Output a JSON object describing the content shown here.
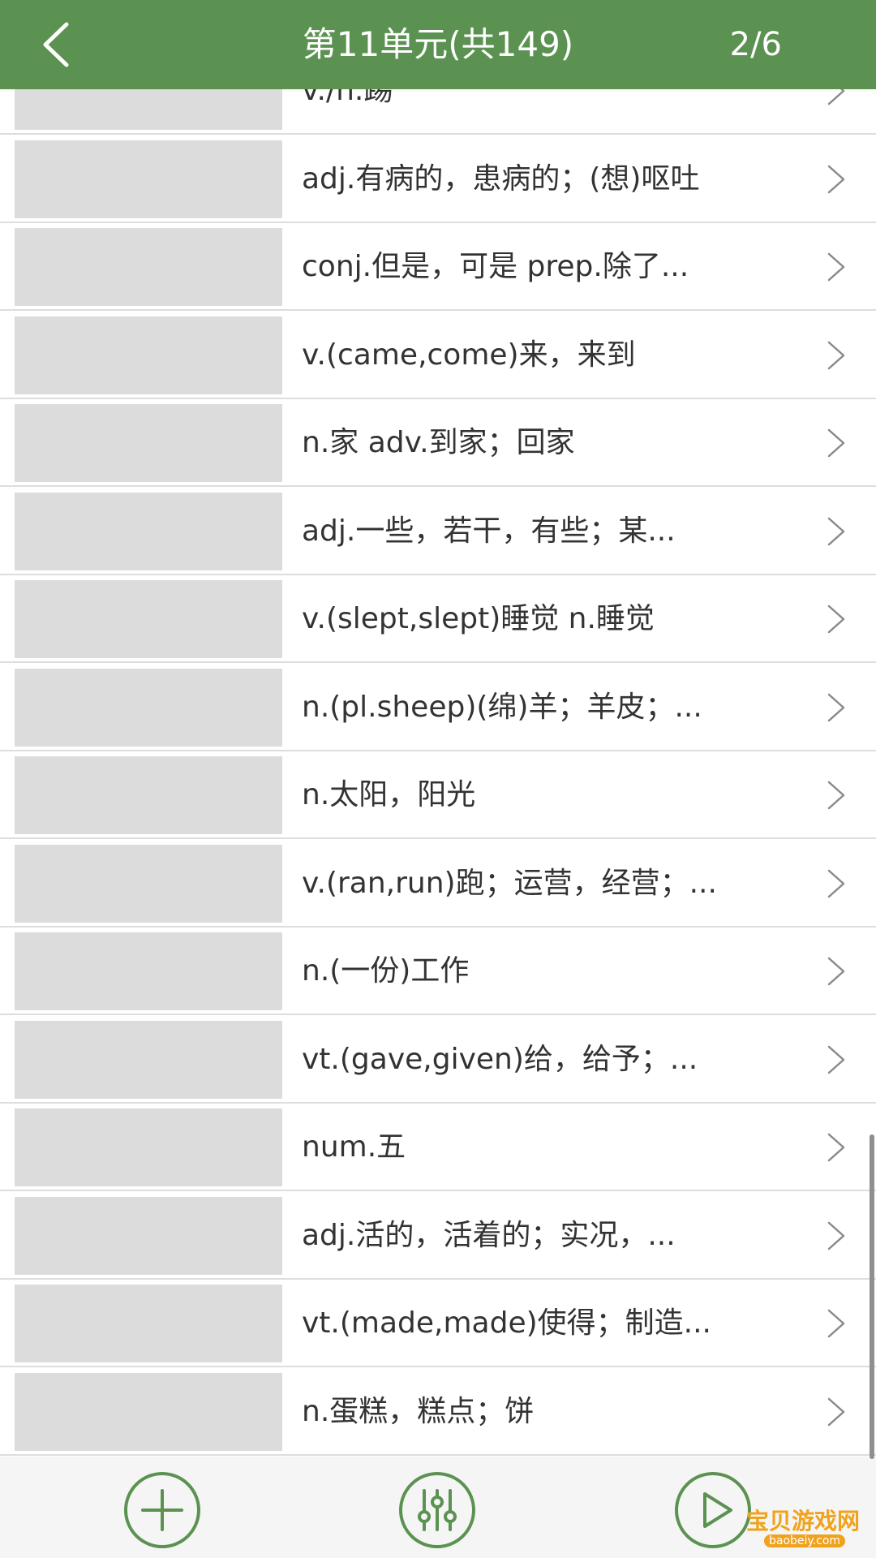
{
  "header": {
    "title": "第11单元(共149)",
    "page_indicator": "2/6",
    "back_icon": "chevron-left-icon",
    "background_color": "#5b9251"
  },
  "words": [
    {
      "meaning": "v./n.踢"
    },
    {
      "meaning": "adj.有病的，患病的；(想)呕吐"
    },
    {
      "meaning": "conj.但是，可是 prep.除了..."
    },
    {
      "meaning": "v.(came,come)来，来到"
    },
    {
      "meaning": "n.家 adv.到家；回家"
    },
    {
      "meaning": "adj.一些，若干，有些；某..."
    },
    {
      "meaning": "v.(slept,slept)睡觉 n.睡觉"
    },
    {
      "meaning": "n.(pl.sheep)(绵)羊；羊皮；..."
    },
    {
      "meaning": "n.太阳，阳光"
    },
    {
      "meaning": "v.(ran,run)跑；运营，经营；..."
    },
    {
      "meaning": "n.(一份)工作"
    },
    {
      "meaning": "vt.(gave,given)给，给予；..."
    },
    {
      "meaning": "num.五"
    },
    {
      "meaning": "adj.活的，活着的；实况，..."
    },
    {
      "meaning": "vt.(made,made)使得；制造..."
    },
    {
      "meaning": "n.蛋糕，糕点；饼"
    }
  ],
  "footer": {
    "add_icon": "plus-circle-icon",
    "settings_icon": "sliders-icon",
    "play_icon": "play-circle-icon",
    "accent_color": "#5b9251"
  },
  "watermark": {
    "text": "宝贝游戏网",
    "url": "baobeiy.com"
  }
}
